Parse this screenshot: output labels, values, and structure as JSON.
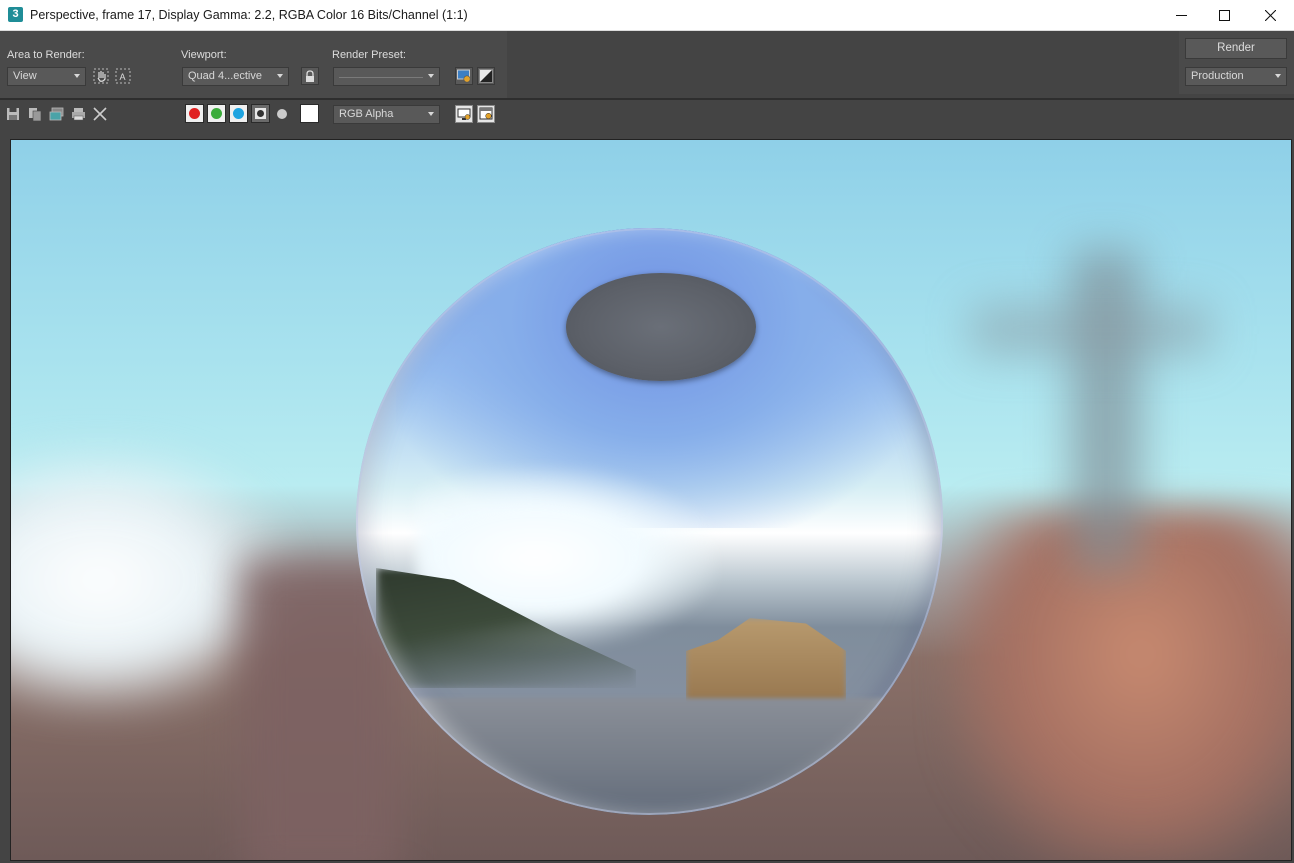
{
  "window": {
    "app_icon_glyph": "3",
    "title": "Perspective, frame 17, Display Gamma: 2.2, RGBA Color 16 Bits/Channel (1:1)",
    "controls": [
      "minimize-icon",
      "maximize-icon",
      "close-icon"
    ]
  },
  "toolbar": {
    "area_to_render_label": "Area to Render:",
    "area_to_render_value": "View",
    "viewport_label": "Viewport:",
    "viewport_value": "Quad 4...ective",
    "render_preset_label": "Render Preset:",
    "render_preset_value": "",
    "render_button": "Render",
    "render_mode_value": "Production",
    "icons": [
      "edit-region-icon",
      "auto-region-icon",
      "lock-viewport-icon",
      "render-setup-icon",
      "environment-icon"
    ]
  },
  "toolbar2": {
    "icons": [
      "save-image-icon",
      "copy-image-icon",
      "clone-window-icon",
      "print-image-icon",
      "clear-icon"
    ],
    "channels": [
      {
        "name": "red-channel",
        "color": "#e02020"
      },
      {
        "name": "green-channel",
        "color": "#3cac3c"
      },
      {
        "name": "blue-channel",
        "color": "#1fa4e0"
      },
      {
        "name": "alpha-channel",
        "color": "#333333"
      },
      {
        "name": "monochrome",
        "color": "#cccccc"
      }
    ],
    "swatch_color": "#ffffff",
    "channel_display_value": "RGB Alpha"
  },
  "colors": {
    "panel_bg": "#444444",
    "panel_section_bg": "#4a4a4a",
    "control_bg": "#595959",
    "text": "#dddddd"
  }
}
